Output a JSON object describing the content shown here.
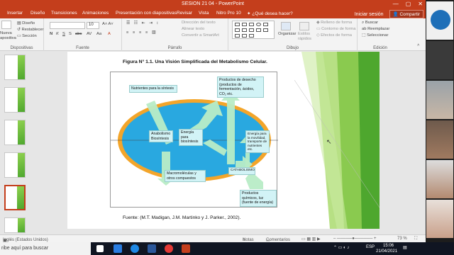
{
  "window": {
    "title": "SESION 21 04 - PowerPoint",
    "controls": [
      "—",
      "▢",
      "✕"
    ]
  },
  "menu": {
    "tabs": [
      "Insertar",
      "Diseño",
      "Transiciones",
      "Animaciones",
      "Presentación con diapositivas",
      "Revisar",
      "Vista",
      "Nitro Pro 10",
      "¿Qué desea hacer?"
    ],
    "signin": "Iniciar sesión",
    "share": "Compartir"
  },
  "ribbon": {
    "dispositivas": {
      "nueva_line1": "Nueva",
      "nueva_line2": "apositiva",
      "items": [
        "Diseño",
        "Restablecer",
        "Sección"
      ],
      "label": "Dispositivas"
    },
    "fuente": {
      "size": "10",
      "label": "Fuente"
    },
    "parrafo": {
      "items": [
        "Dirección del texto",
        "Alinear texto",
        "Convertir a SmartArt"
      ],
      "label": "Párrafo"
    },
    "dibujo": {
      "organizar": "Organizar",
      "estilos_line1": "Estilos",
      "estilos_line2": "rápidos",
      "items": [
        "Relleno de forma",
        "Contorno de forma",
        "Efectos de forma"
      ],
      "label": "Dibujo"
    },
    "edicion": {
      "items": [
        "Buscar",
        "Reemplazar",
        "Seleccionar"
      ],
      "label": "Edición"
    }
  },
  "slide": {
    "figure_title": "Figura N° 1.1. Una Visión Simplificada del Metabolismo Celular.",
    "source": "Fuente: (M.T. Madigan, J.M. Martinko y J. Parker., 2002).",
    "labels": {
      "nutrientes": "Nutrientes para la síntesis",
      "productos_desecho": "Productos de desecho (productos de fermentación, ácidos, CO₂ etc.",
      "anabolismo": "Anabolismo Biosíntesis",
      "energia_biosintesis": "Energía para biosíntesis",
      "energia_movilidad": "Energía para la movilidad, transporte de nutrientes etc.",
      "macromoleculas": "Macromoléculas y otros compuestos",
      "catabolismo": "CATABOLISMO",
      "productos_quimicos": "Productos químicos, luz (fuente de energía)"
    }
  },
  "statusbar": {
    "language": "Inglés (Estados Unidos)",
    "notes": "Notas",
    "comments": "Comentarios",
    "zoom": "73 %"
  },
  "taskbar": {
    "search": "ribe aquí para buscar",
    "lang": "ESP",
    "time": "15:06",
    "date": "21/04/2021"
  },
  "colors": {
    "accent": "#c43e1c",
    "ellipse_fill": "#29a8e0",
    "ellipse_border": "#f3a52a",
    "arrow": "#b8ecc6",
    "green_dark": "#4ea72e",
    "green_light": "#9fd65b"
  }
}
